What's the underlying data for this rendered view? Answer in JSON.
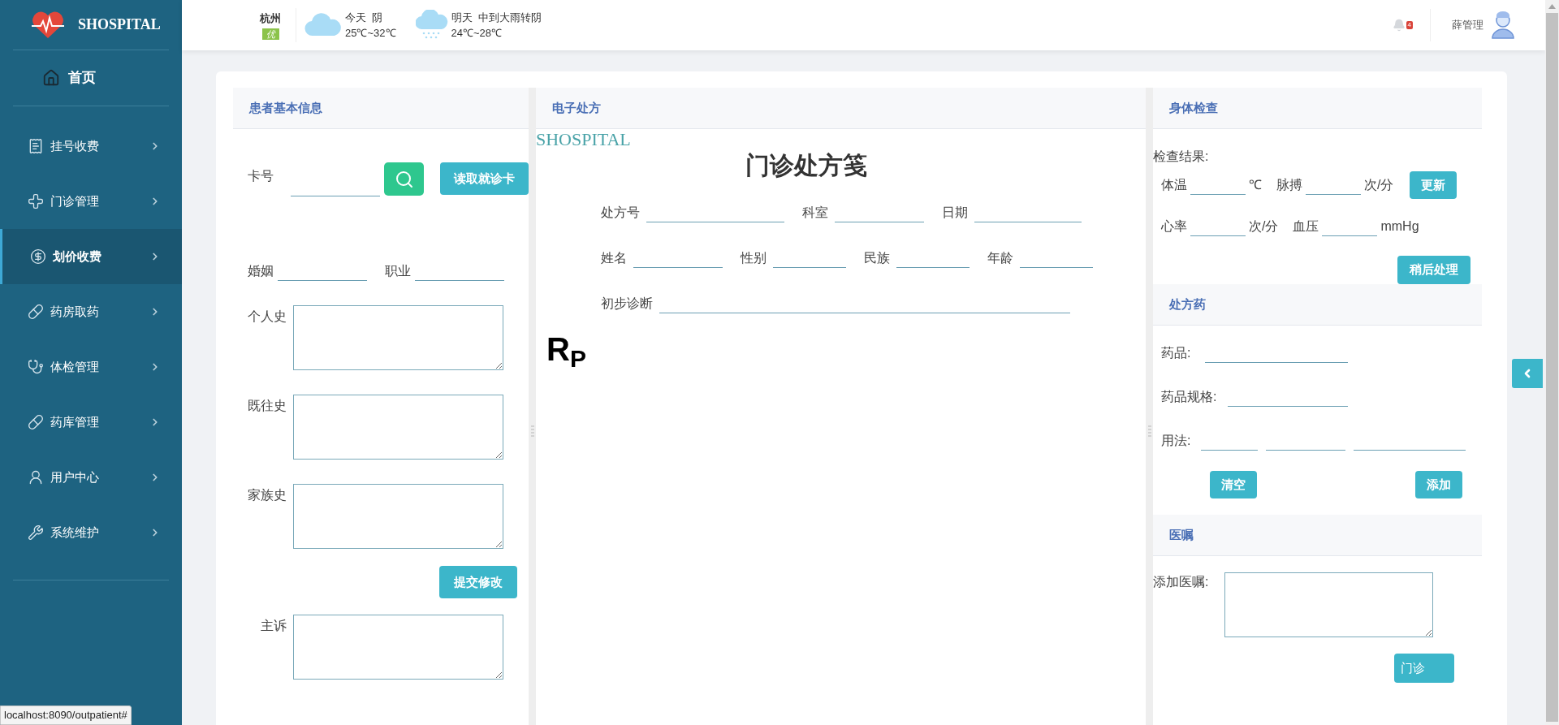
{
  "app": {
    "logo": "SHOSPITAL"
  },
  "sidebar": {
    "home": "首页",
    "items": [
      {
        "label": "挂号收费",
        "selected": false
      },
      {
        "label": "门诊管理",
        "selected": false
      },
      {
        "label": "划价收费",
        "selected": true
      },
      {
        "label": "药房取药",
        "selected": false
      },
      {
        "label": "体检管理",
        "selected": false
      },
      {
        "label": "药库管理",
        "selected": false
      },
      {
        "label": "用户中心",
        "selected": false
      },
      {
        "label": "系统维护",
        "selected": false
      }
    ]
  },
  "header": {
    "city": "杭州",
    "air_quality": "优",
    "days": [
      {
        "kind": "cloudy",
        "label": "今天  阴",
        "temp": "25℃~32℃"
      },
      {
        "kind": "rain",
        "label": "明天  中到大雨转阴",
        "temp": "24℃~28℃"
      }
    ],
    "notifications": "4",
    "user": "薛管理"
  },
  "patient_panel": {
    "title": "患者基本信息",
    "card_label": "卡号",
    "read_card_button": "读取就诊卡",
    "marriage_label": "婚姻",
    "occupation_label": "职业",
    "history_labels": [
      "个人史",
      "既往史",
      "家族史"
    ],
    "submit_button": "提交修改",
    "complaint_label": "主诉"
  },
  "prescription_panel": {
    "title": "电子处方",
    "brand": "SHOSPITAL",
    "heading": "门诊处方笺",
    "rows": [
      [
        {
          "label": "处方号"
        },
        {
          "label": "科室"
        },
        {
          "label": "日期"
        }
      ],
      [
        {
          "label": "姓名"
        },
        {
          "label": "性别"
        },
        {
          "label": "民族"
        },
        {
          "label": "年龄"
        }
      ],
      [
        {
          "label": "初步诊断"
        }
      ]
    ],
    "rp": "R$_{P}$"
  },
  "exam_panel": {
    "title": "身体检查",
    "results_label": "检查结果:",
    "vitals": [
      [
        {
          "label": "体温",
          "unit": "℃"
        },
        {
          "label": "脉搏",
          "unit": "次/分"
        }
      ],
      [
        {
          "label": "心率",
          "unit": "次/分"
        },
        {
          "label": "血压",
          "unit": "mmHg"
        }
      ]
    ],
    "update_button": "更新",
    "later_button": "稍后处理"
  },
  "drug_panel": {
    "title": "处方药",
    "drug_label": "药品:",
    "spec_label": "药品规格:",
    "usage_label": "用法:",
    "clear_button": "清空",
    "add_button": "添加"
  },
  "advice_panel": {
    "title": "医嘱",
    "advice_label": "添加医嘱:",
    "outpatient_button": "门诊"
  },
  "status_url": "localhost:8090/outpatient#"
}
